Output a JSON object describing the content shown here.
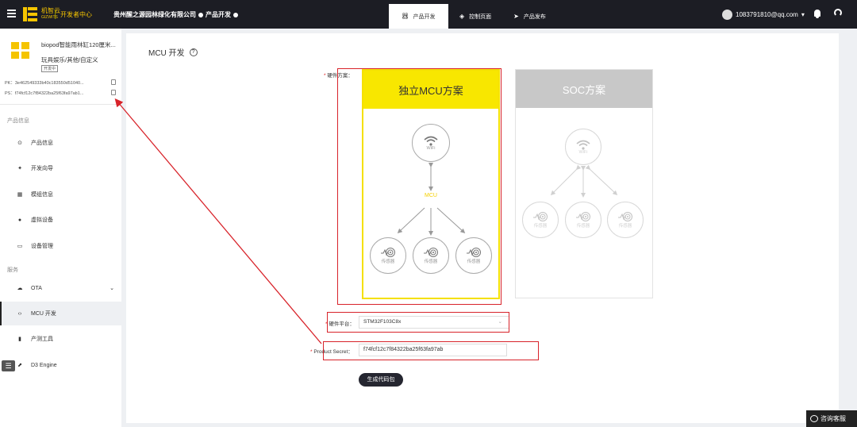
{
  "topbar": {
    "brand": "机智云",
    "brand_en": "GIZWITS",
    "dev_center": "开发者中心",
    "company": "贵州醒之源园林绿化有限公司",
    "product_menu": "产品开发",
    "tabs": [
      {
        "label": "产品开发",
        "icon": "grid-icon"
      },
      {
        "label": "控制页面",
        "icon": "diamond-icon"
      },
      {
        "label": "产品发布",
        "icon": "send-icon"
      }
    ],
    "user": "1083791810@qq.com",
    "accent": "#f5c400"
  },
  "product": {
    "name": "biopod智能雨林缸120厘米...",
    "category": "玩具娱乐/其他/自定义",
    "tag": "开发中",
    "pk": "PK：3e462549333b40c183550d51040...",
    "ps": "PS：f74fcf12c7f84322ba25f63fa97ab1..."
  },
  "sidebar": {
    "section_info": "产品信息",
    "items_info": [
      {
        "label": "产品信息",
        "icon": "info-icon"
      },
      {
        "label": "开发向导",
        "icon": "pin-icon"
      },
      {
        "label": "模组信息",
        "icon": "module-icon"
      },
      {
        "label": "虚拟设备",
        "icon": "device-icon"
      },
      {
        "label": "设备管理",
        "icon": "manage-icon"
      }
    ],
    "section_service": "服务",
    "items_service": [
      {
        "label": "OTA",
        "icon": "cloud-icon"
      },
      {
        "label": "MCU 开发",
        "icon": "code-icon"
      },
      {
        "label": "产测工具",
        "icon": "tool-icon"
      },
      {
        "label": "D3 Engine",
        "icon": "engine-icon"
      }
    ]
  },
  "main": {
    "title": "MCU 开发",
    "hw_label": "硬件方案：",
    "card_mcu": {
      "title": "独立MCU方案",
      "wifi": "WiFi",
      "mcu": "MCU",
      "sensor": "传感器"
    },
    "card_soc": {
      "title": "SOC方案",
      "wifi": "WiFi",
      "sensor": "传感器"
    },
    "platform_label": "硬件平台：",
    "platform_value": "STM32F103C8x",
    "secret_label": "Product Secret：",
    "secret_value": "f74fcf12c7f84322ba25f63fa97ab",
    "generate": "生成代码包"
  },
  "service": "咨询客服"
}
